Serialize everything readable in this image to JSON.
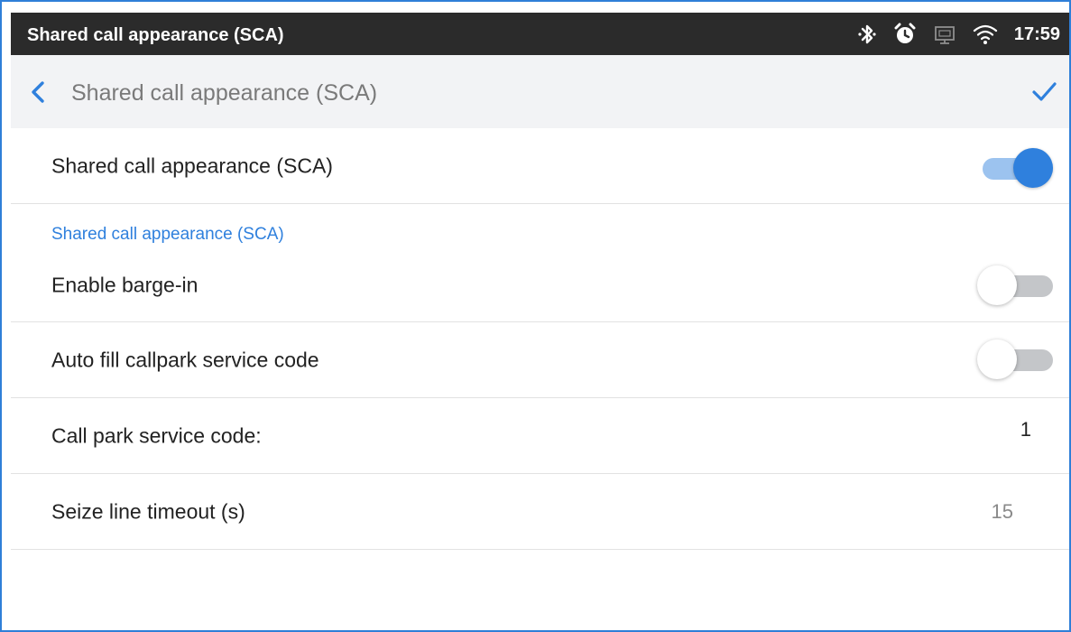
{
  "status_bar": {
    "title": "Shared call appearance (SCA)",
    "time": "17:59",
    "icons": [
      "bluetooth-icon",
      "alarm-clock-icon",
      "monitor-icon",
      "wifi-icon"
    ]
  },
  "app_bar": {
    "title": "Shared call appearance (SCA)",
    "back_icon": "chevron-left-icon",
    "confirm_icon": "checkmark-icon"
  },
  "settings": {
    "sca_toggle": {
      "label": "Shared call appearance (SCA)",
      "enabled": true
    },
    "section_header": "Shared call appearance (SCA)",
    "barge_in": {
      "label": "Enable barge-in",
      "enabled": false
    },
    "auto_fill": {
      "label": "Auto fill callpark service code",
      "enabled": false
    },
    "call_park": {
      "label": "Call park service code:",
      "value": "1"
    },
    "seize_timeout": {
      "label": "Seize line timeout (s)",
      "value": "15"
    }
  },
  "colors": {
    "accent": "#2f80dd",
    "status_bar_bg": "#2b2b2b",
    "app_bar_bg": "#f2f3f5",
    "switch_track_on": "#9cc3ef",
    "switch_track_off": "#c4c6c9",
    "secondary_value": "#8a8a8a"
  }
}
